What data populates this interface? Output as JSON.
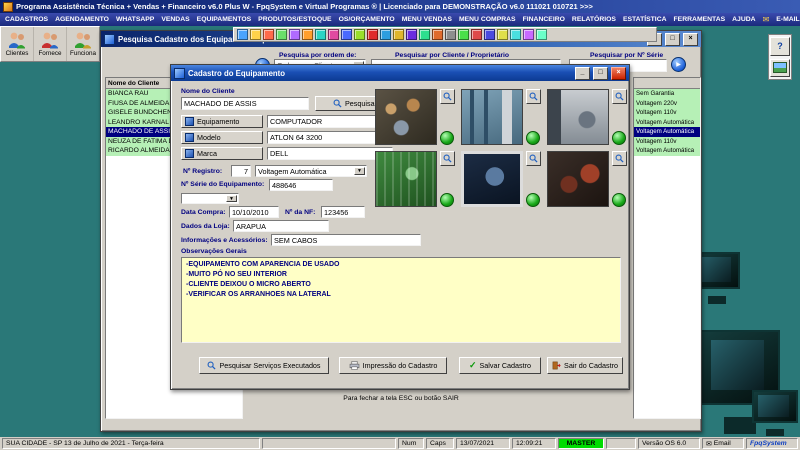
{
  "titlebar": {
    "title": "Programa Assistência Técnica + Vendas + Financeiro v6.0 Plus W  -  FpqSystem e Virtual Programas ®  | Licenciado para  DEMONSTRAÇÃO v6.0 111021 010721 >>>"
  },
  "menubar": {
    "items": [
      "CADASTROS",
      "AGENDAMENTO",
      "WHATSAPP",
      "VENDAS",
      "EQUIPAMENTOS",
      "PRODUTOS/ESTOQUE",
      "OS/ORÇAMENTO",
      "MENU VENDAS",
      "MENU COMPRAS",
      "FINANCEIRO",
      "RELATÓRIOS",
      "ESTATÍSTICA",
      "FERRAMENTAS",
      "AJUDA"
    ],
    "email": "E-MAIL"
  },
  "toolbar": {
    "big_buttons": [
      {
        "label": "Clientes"
      },
      {
        "label": "Fornece"
      },
      {
        "label": "Funciona"
      }
    ]
  },
  "icons": {
    "minimize": "_",
    "maximize": "□",
    "close": "×",
    "dropdown": "▼",
    "go": "▶",
    "check": "✓",
    "envelope": "✉",
    "help": "?"
  },
  "search_window": {
    "title": "Pesquisa Cadastro dos Equipamentos por Cliente",
    "order_label": "Pesquisa por ordem de:",
    "order_value": "Ordem por Cliente",
    "client_filter_label": "Pesquisar por Cliente / Proprietário",
    "serial_filter_label": "Pesquisar por Nº Série",
    "list_header": "Nome do Cliente",
    "clients": [
      "BIANCA RAU",
      "FIUSA DE ALMEIDA JUNIOR",
      "GISELE BUNDCHEN",
      "LEANDRO KARNAL",
      "MACHADO DE ASSIS",
      "NEUZA DE FATIMA DA SILVA",
      "RICARDO ALMEIDA"
    ],
    "right_cells": [
      "Sem Garantia",
      "Voltagem 220v",
      "Voltagem 110v",
      "Voltagem Automática",
      "Voltagem Automática",
      "Voltagem 110v",
      "Voltagem Automática"
    ],
    "footer_hint": "Para fechar a tela ESC ou botão SAIR"
  },
  "dialog": {
    "title": "Cadastro do Equipamento",
    "client_label": "Nome do Cliente",
    "client_value": "MACHADO DE ASSIS",
    "search_button": "Pesquisar",
    "equipment_label": "Equipamento",
    "equipment_value": "COMPUTADOR",
    "model_label": "Modelo",
    "model_value": "ATLON 64 3200",
    "brand_label": "Marca",
    "brand_value": "DELL",
    "registry_label": "Nº Registro:",
    "registry_value": "7",
    "voltage_value": "Voltagem Automática",
    "serial_label": "Nº Série do Equipamento:",
    "serial_value": "488646",
    "purchase_label": "Data Compra:",
    "purchase_value": "10/10/2010",
    "nf_label": "Nº da NF:",
    "nf_value": "123456",
    "store_label": "Dados da Loja:",
    "store_value": "ARAPUA",
    "accessories_label": "Informações e Acessórios:",
    "accessories_value": "SEM CABOS",
    "obs_label": "Observações Gerais",
    "obs_text": "-EQUIPAMENTO COM APARENCIA DE USADO\n-MUITO PÓ NO SEU INTERIOR\n-CLIENTE DEIXOU O MICRO ABERTO\n-VERIFICAR OS ARRANHOES NA LATERAL",
    "buttons": {
      "services": "Pesquisar Serviços Executados",
      "print": "Impressão do Cadastro",
      "save": "Salvar Cadastro",
      "exit": "Sair do Cadastro"
    }
  },
  "statusbar": {
    "location": "SUA CIDADE  - SP 13 de Julho de 2021 - Terça-feira",
    "num": "Num",
    "caps": "Caps",
    "date": "13/07/2021",
    "time": "12:09:21",
    "master": "MASTER",
    "version": "Versão OS 6.0",
    "email": "Email",
    "brand": "FpqSystem"
  }
}
